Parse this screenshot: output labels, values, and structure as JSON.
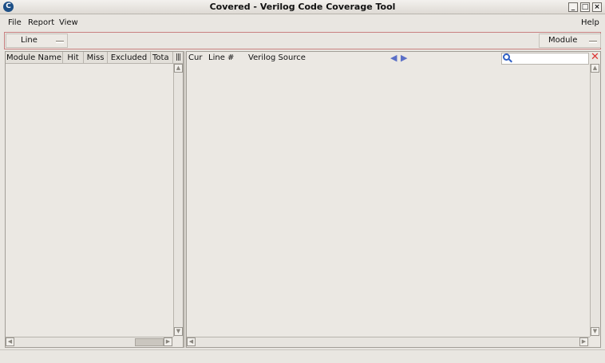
{
  "window": {
    "title": "Covered - Verilog Code Coverage Tool",
    "app_icon_glyph": "C",
    "minimize_glyph": "_",
    "maximize_glyph": "□",
    "close_glyph": "×"
  },
  "menu": {
    "file": "File",
    "report": "Report",
    "view": "View",
    "help": "Help"
  },
  "toolbar": {
    "metric_select": "Line",
    "view_select": "Module"
  },
  "left_table": {
    "columns": [
      "Module Name",
      "Hit",
      "Miss",
      "Excluded",
      "Tota"
    ],
    "rows": []
  },
  "source_view": {
    "col_cur": "Cur",
    "col_line": "Line #",
    "col_source": "Verilog Source",
    "prev_glyph": "◀",
    "next_glyph": "▶",
    "search_value": "",
    "clear_glyph": "✕"
  },
  "icons": {
    "app": "app-icon",
    "search": "search-icon",
    "clear": "clear-icon",
    "prev": "prev-arrow-icon",
    "next": "next-arrow-icon"
  },
  "colors": {
    "toolbar_border": "#c88080",
    "nav_arrow": "#5a6fc7",
    "clear_icon": "#dd3333",
    "search_icon": "#2f5fc4"
  }
}
